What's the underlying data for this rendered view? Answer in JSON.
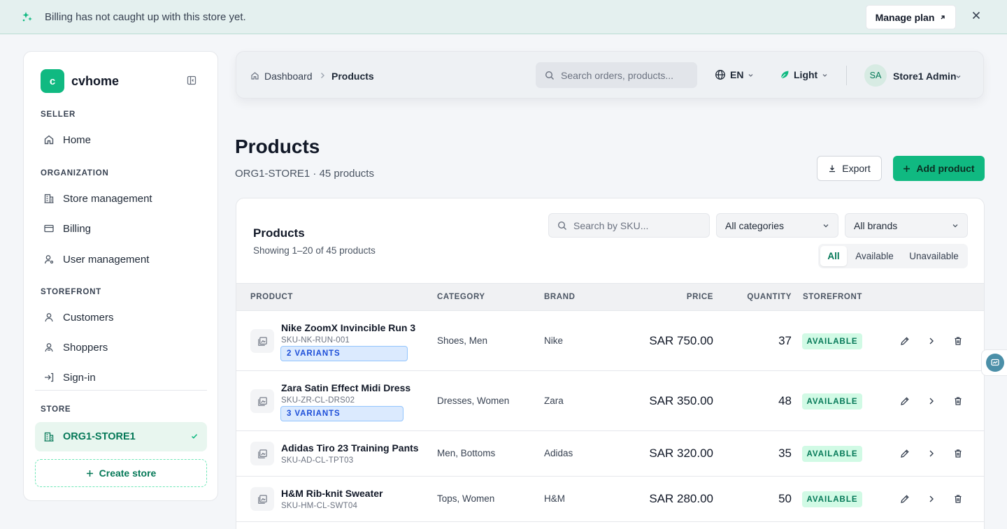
{
  "banner": {
    "message": "Billing has not caught up with this store yet.",
    "manage_label": "Manage plan"
  },
  "sidebar": {
    "brand_initial": "c",
    "brand_name": "cvhome",
    "sections": {
      "seller": "SELLER",
      "organization": "ORGANIZATION",
      "storefront": "STOREFRONT",
      "store": "STORE"
    },
    "items": {
      "home": "Home",
      "store_management": "Store management",
      "billing": "Billing",
      "user_management": "User management",
      "customers": "Customers",
      "shoppers": "Shoppers",
      "signin": "Sign-in"
    },
    "current_store": "ORG1-STORE1",
    "create_store": "Create store"
  },
  "topbar": {
    "breadcrumb": [
      "Dashboard",
      "Products"
    ],
    "search_placeholder": "Search orders, products...",
    "language": "EN",
    "theme": "Light",
    "avatar_initials": "SA",
    "user_name": "Store1 Admin"
  },
  "page": {
    "title": "Products",
    "subtitle": "ORG1-STORE1 · 45 products",
    "export_label": "Export",
    "add_label": "Add product"
  },
  "card": {
    "title": "Products",
    "subtitle": "Showing 1–20 of 45 products",
    "sku_placeholder": "Search by SKU...",
    "category_select": "All categories",
    "brand_select": "All brands",
    "filters": [
      "All",
      "Available",
      "Unavailable"
    ],
    "active_filter": "All"
  },
  "table": {
    "columns": [
      "PRODUCT",
      "CATEGORY",
      "BRAND",
      "PRICE",
      "QUANTITY",
      "STOREFRONT"
    ],
    "rows": [
      {
        "name": "Nike ZoomX Invincible Run 3",
        "sku": "SKU-NK-RUN-001",
        "variants": "2 VARIANTS",
        "category": "Shoes, Men",
        "brand": "Nike",
        "price": "SAR 750.00",
        "quantity": "37",
        "status": "AVAILABLE"
      },
      {
        "name": "Zara Satin Effect Midi Dress",
        "sku": "SKU-ZR-CL-DRS02",
        "variants": "3 VARIANTS",
        "category": "Dresses, Women",
        "brand": "Zara",
        "price": "SAR 350.00",
        "quantity": "48",
        "status": "AVAILABLE"
      },
      {
        "name": "Adidas Tiro 23 Training Pants",
        "sku": "SKU-AD-CL-TPT03",
        "variants": "",
        "category": "Men, Bottoms",
        "brand": "Adidas",
        "price": "SAR 320.00",
        "quantity": "35",
        "status": "AVAILABLE"
      },
      {
        "name": "H&M Rib-knit Sweater",
        "sku": "SKU-HM-CL-SWT04",
        "variants": "",
        "category": "Tops, Women",
        "brand": "H&M",
        "price": "SAR 280.00",
        "quantity": "50",
        "status": "AVAILABLE"
      }
    ]
  },
  "colors": {
    "accent": "#10b981",
    "accent_dark": "#047857",
    "banner_bg": "#e4f0ef",
    "page_bg": "#f4f6f9"
  }
}
